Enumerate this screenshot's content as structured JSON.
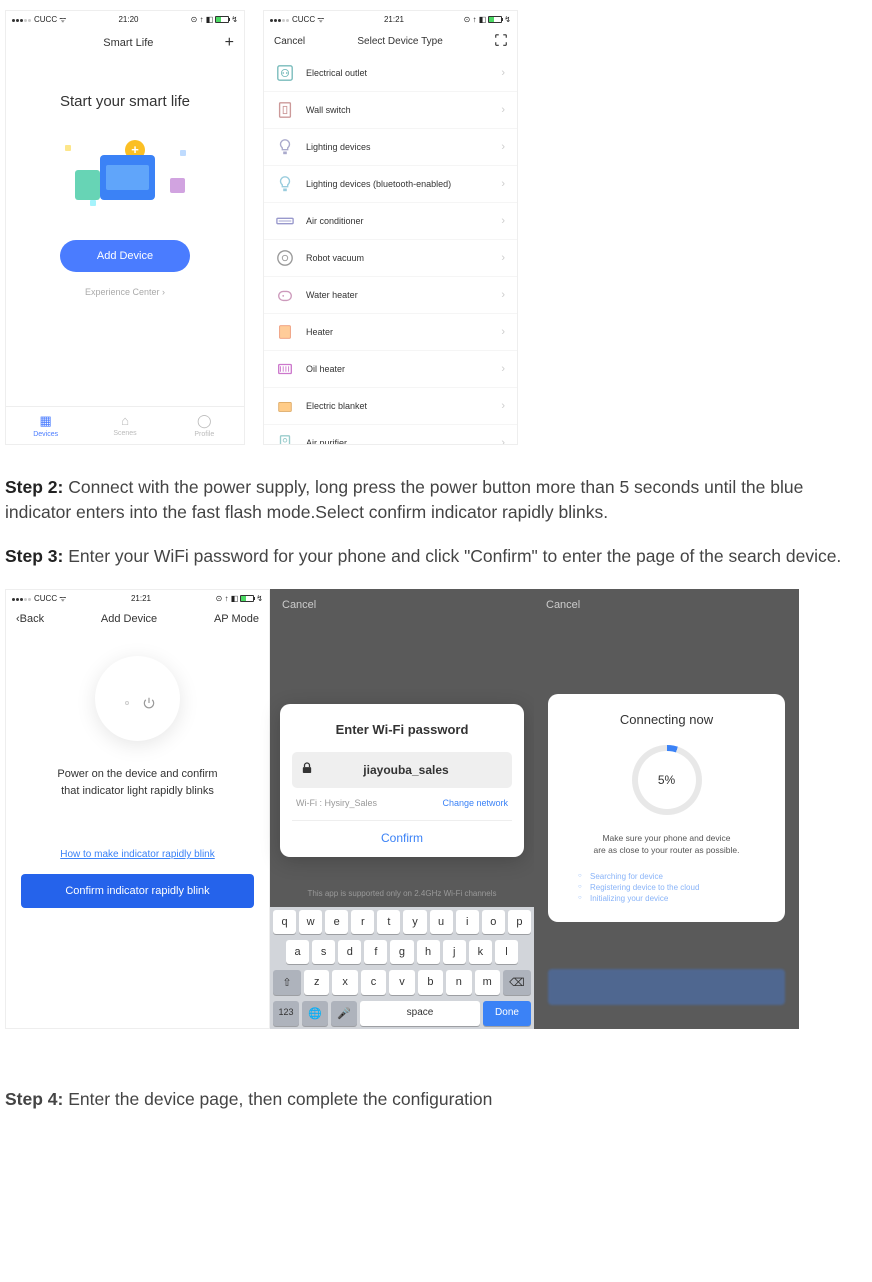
{
  "statusbar": {
    "carrier": "CUCC",
    "time1": "21:20",
    "time2": "21:21",
    "wifi": "wifi-icon"
  },
  "screen1": {
    "nav_title": "Smart Life",
    "heading": "Start your smart life",
    "add_device": "Add Device",
    "experience": "Experience Center ›",
    "tabs": [
      "Devices",
      "Scenes",
      "Profile"
    ]
  },
  "screen2": {
    "cancel": "Cancel",
    "title": "Select Device Type",
    "items": [
      "Electrical outlet",
      "Wall switch",
      "Lighting devices",
      "Lighting devices (bluetooth-enabled)",
      "Air conditioner",
      "Robot vacuum",
      "Water heater",
      "Heater",
      "Oil heater",
      "Electric blanket",
      "Air purifier"
    ]
  },
  "step2_label": "Step 2:",
  "step2_text": " Connect with the power supply, long press the power button more than 5 seconds until the blue indicator enters into the fast flash mode.Select confirm indicator rapidly blinks.",
  "step3_label": "Step 3:",
  "step3_text": " Enter your WiFi password for your phone and click \"Confirm\" to enter the page of the search device.",
  "screen3": {
    "back": "Back",
    "title": "Add Device",
    "mode": "AP Mode",
    "text1": "Power on the device and confirm",
    "text2": "that indicator light rapidly blinks",
    "link": "How to make indicator rapidly blink",
    "button": "Confirm indicator rapidly blink"
  },
  "screen4": {
    "cancel": "Cancel",
    "title": "Enter Wi-Fi password",
    "password": "jiayouba_sales",
    "wifi_label": "Wi-Fi : Hysiry_Sales",
    "change": "Change network",
    "confirm": "Confirm",
    "note": "This app is supported only on 2.4GHz Wi-Fi channels",
    "space": "space",
    "done": "Done",
    "num": "123"
  },
  "screen5": {
    "cancel": "Cancel",
    "title": "Connecting now",
    "percent": "5%",
    "note1": "Make sure your phone and device",
    "note2": "are as close to your router as possible.",
    "bullets": [
      "Searching for device",
      "Registering device to the cloud",
      "Initializing your device"
    ]
  },
  "step4_label": "Step 4:",
  "step4_text": " Enter the device page, then complete the configuration"
}
